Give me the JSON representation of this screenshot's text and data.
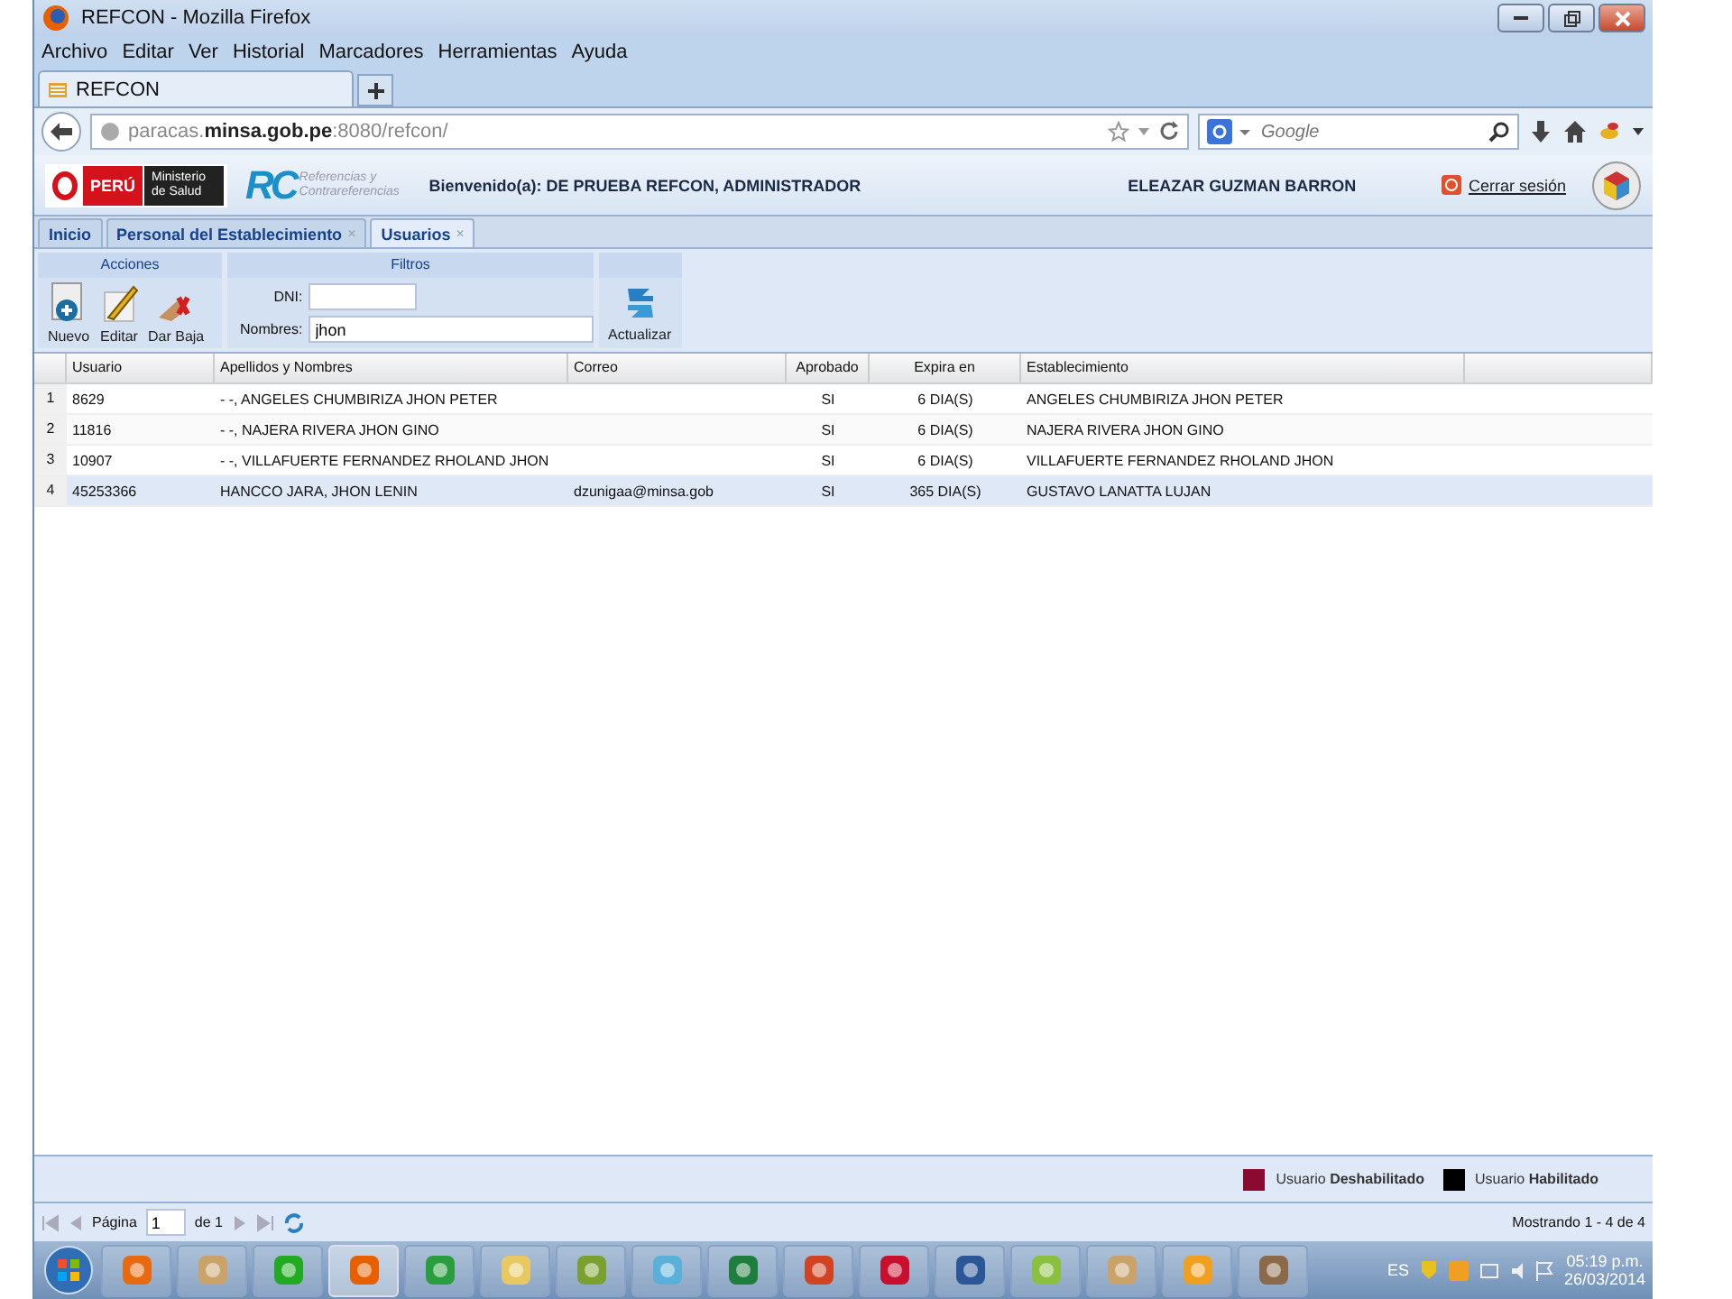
{
  "window": {
    "title": "REFCON - Mozilla Firefox"
  },
  "menu": [
    "Archivo",
    "Editar",
    "Ver",
    "Historial",
    "Marcadores",
    "Herramientas",
    "Ayuda"
  ],
  "browser_tab": {
    "title": "REFCON"
  },
  "address_bar": {
    "host_prefix": "paracas.",
    "host_domain": "minsa.gob.pe",
    "rest": ":8080/refcon/"
  },
  "search": {
    "placeholder": "Google"
  },
  "header": {
    "country": "PERÚ",
    "ministry": "Ministerio de Salud",
    "logo_letters": "RC",
    "logo_caption": "Referencias y Contrareferencias",
    "welcome": "Bienvenido(a): DE PRUEBA REFCON, ADMINISTRADOR",
    "user": "ELEAZAR GUZMAN BARRON",
    "logout": "Cerrar sesión"
  },
  "app_tabs": [
    {
      "label": "Inicio",
      "selected": false
    },
    {
      "label": "Personal del Establecimiento",
      "close": "×",
      "selected": false
    },
    {
      "label": "Usuarios",
      "close": "×",
      "selected": true
    }
  ],
  "toolbar": {
    "actions_title": "Acciones",
    "actions": [
      {
        "kind": "new",
        "label": "Nuevo"
      },
      {
        "kind": "edit",
        "label": "Editar"
      },
      {
        "kind": "remove",
        "label": "Dar Baja"
      }
    ],
    "filters_title": "Filtros",
    "filters": [
      {
        "label": "DNI:"
      },
      {
        "label": "Nombres:",
        "value": "jhon"
      }
    ],
    "refresh": "Actualizar"
  },
  "table": {
    "columns": [
      "Usuario",
      "Apellidos y Nombres",
      "Correo",
      "Aprobado",
      "Expira en",
      "Establecimiento"
    ],
    "rows": [
      {
        "number": "1",
        "cells": [
          "8629",
          "- -, ANGELES CHUMBIRIZA JHON PETER",
          "",
          "SI",
          "6 DIA(S)",
          "ANGELES CHUMBIRIZA JHON PETER"
        ],
        "selected": false
      },
      {
        "number": "2",
        "cells": [
          "11816",
          "- -, NAJERA RIVERA JHON GINO",
          "",
          "SI",
          "6 DIA(S)",
          "NAJERA RIVERA JHON GINO"
        ],
        "selected": false
      },
      {
        "number": "3",
        "cells": [
          "10907",
          "- -, VILLAFUERTE FERNANDEZ RHOLAND JHON",
          "",
          "SI",
          "6 DIA(S)",
          "VILLAFUERTE FERNANDEZ RHOLAND JHON"
        ],
        "selected": false
      },
      {
        "number": "4",
        "cells": [
          "45253366",
          "HANCCO JARA, JHON LENIN",
          "dzunigaa@minsa.gob",
          "SI",
          "365 DIA(S)",
          "GUSTAVO LANATTA LUJAN"
        ],
        "selected": true
      }
    ]
  },
  "legend": [
    {
      "label": "Usuario **Deshabilitado**",
      "color": "#8b0a32"
    },
    {
      "label": "Usuario **Habilitado**",
      "color": "#000000"
    }
  ],
  "paging": {
    "page_label": "Página",
    "page": "1",
    "of": "de 1",
    "summary": "Mostrando 1 - 4 de 4"
  },
  "tray": {
    "language": "ES",
    "time": "05:19 p.m.",
    "date": "26/03/2014"
  }
}
